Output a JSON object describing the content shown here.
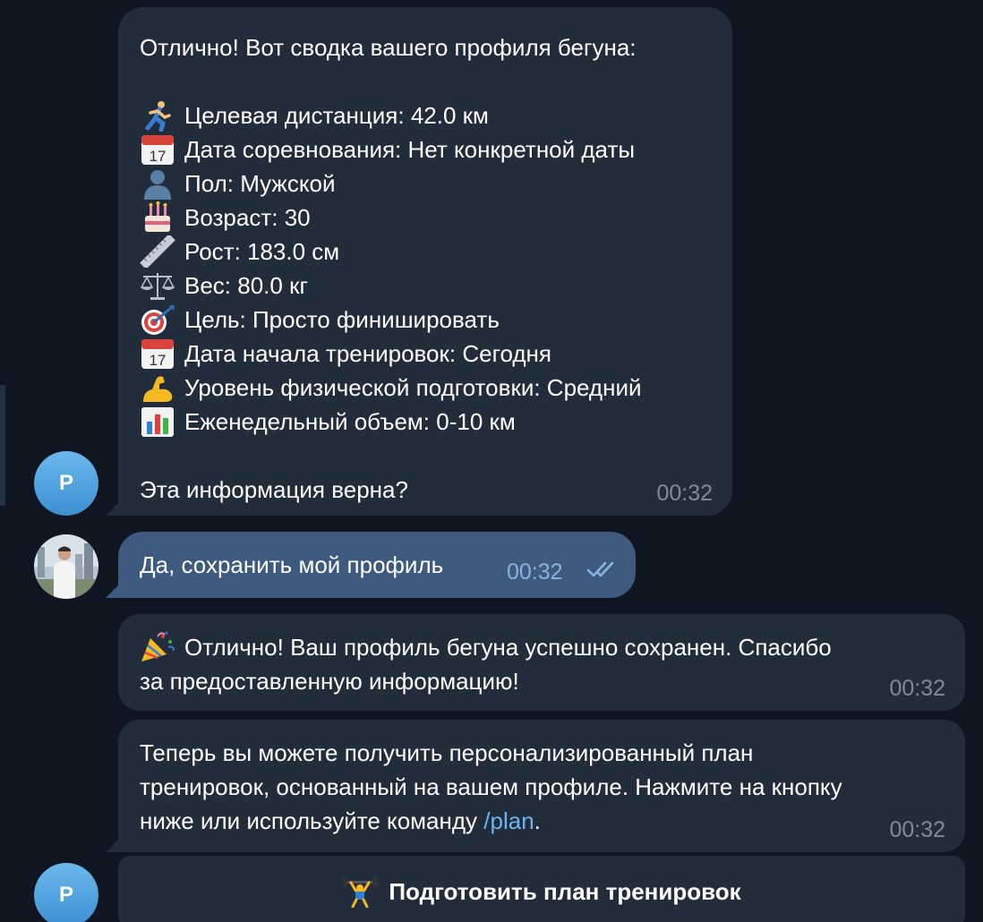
{
  "messages": {
    "summary": {
      "intro": "Отлично! Вот сводка вашего профиля бегуна:",
      "items": [
        {
          "icon": "runner-icon",
          "text": "Целевая дистанция: 42.0 км"
        },
        {
          "icon": "calendar-icon",
          "text": "Дата соревнования: Нет конкретной даты"
        },
        {
          "icon": "person-silhouette-icon",
          "text": "Пол: Мужской"
        },
        {
          "icon": "birthday-cake-icon",
          "text": "Возраст: 30"
        },
        {
          "icon": "ruler-icon",
          "text": "Рост: 183.0 см"
        },
        {
          "icon": "scales-icon",
          "text": "Вес: 80.0 кг"
        },
        {
          "icon": "target-icon",
          "text": "Цель: Просто финишировать"
        },
        {
          "icon": "calendar-icon",
          "text": "Дата начала тренировок: Сегодня"
        },
        {
          "icon": "flexed-biceps-icon",
          "text": "Уровень физической подготовки: Средний"
        },
        {
          "icon": "bar-chart-icon",
          "text": "Еженедельный объем: 0-10 км"
        }
      ],
      "question": "Эта информация верна?",
      "time": "00:32"
    },
    "user_reply": {
      "text": "Да, сохранить мой профиль",
      "time": "00:32",
      "status": "read"
    },
    "saved": {
      "icon": "party-popper-icon",
      "line1": "Отлично! Ваш профиль бегуна успешно сохранен. Спасибо",
      "line2": "за предоставленную информацию!",
      "time": "00:32"
    },
    "plan_hint": {
      "line1": "Теперь вы можете получить персонализированный план",
      "line2": "тренировок, основанный на вашем профиле. Нажмите на кнопку",
      "line3_prefix": "ниже или используйте команду ",
      "command": "/plan",
      "line3_suffix": ".",
      "time": "00:32"
    }
  },
  "bot_avatar": {
    "letter": "P"
  },
  "keyboard_button": {
    "icon": "weightlifter-icon",
    "label": "Подготовить план тренировок"
  },
  "colors": {
    "background": "#0f1621",
    "incoming_bubble": "#212d3b",
    "outgoing_bubble": "#3e5a7e",
    "avatar": "#4a9fe0",
    "link": "#6fb3f0"
  }
}
